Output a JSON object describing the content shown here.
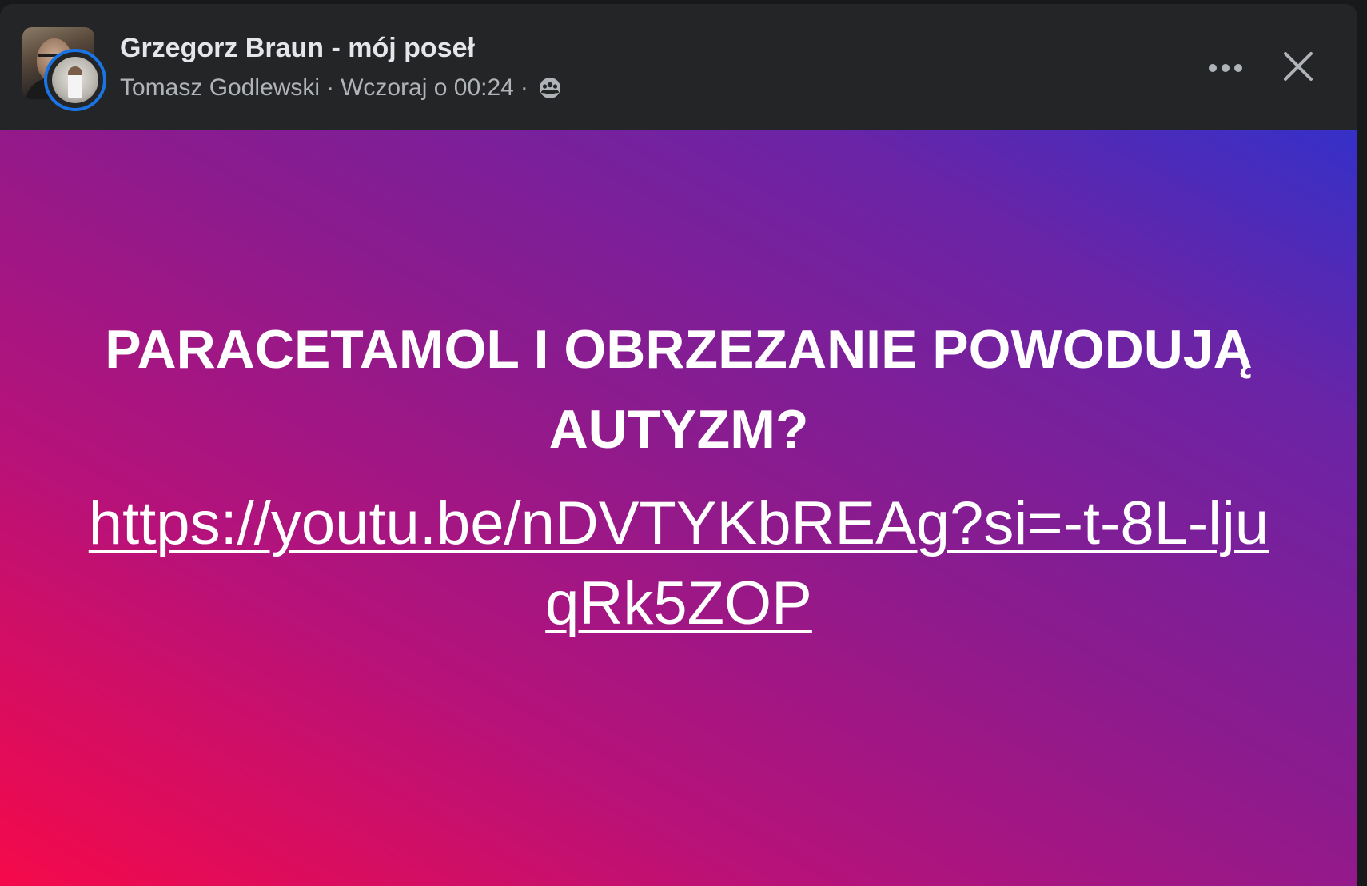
{
  "header": {
    "group_name": "Grzegorz Braun - mój poseł",
    "author": "Tomasz Godlewski",
    "separator": "·",
    "timestamp": "Wczoraj o 00:24",
    "privacy_icon": "group-members-icon",
    "more_icon": "more-options-icon",
    "close_icon": "close-icon"
  },
  "post": {
    "headline": "PARACETAMOL I OBRZEZANIE POWODUJĄ AUTYZM?",
    "link": "https://youtu.be/nDVTYKbREAg?si=-t-8L-ljuqRk5ZOP",
    "background_colors": [
      "#f5094a",
      "#8b1b8e",
      "#3530c8"
    ]
  },
  "colors": {
    "accent_ring": "#1b74e4",
    "header_bg": "#242526",
    "primary_text": "#e4e6eb",
    "secondary_text": "#b0b3b8"
  }
}
